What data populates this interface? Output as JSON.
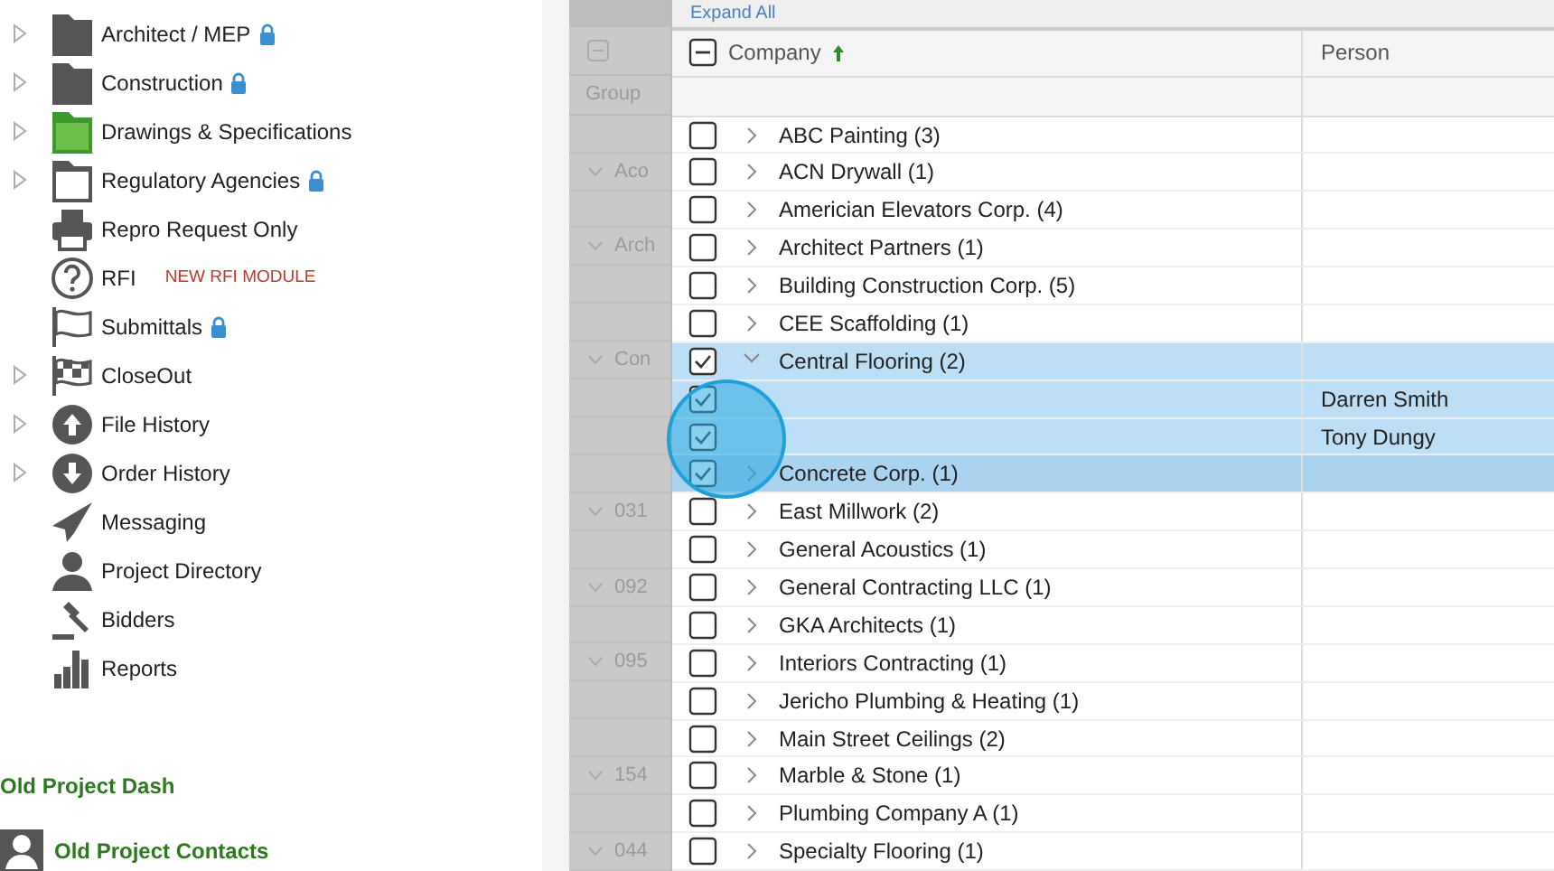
{
  "sidebar": {
    "items": [
      {
        "label": "Architect / MEP",
        "kind": "folder-dark",
        "expandable": true,
        "locked": true
      },
      {
        "label": "Construction",
        "kind": "folder-dark",
        "expandable": true,
        "locked": true
      },
      {
        "label": "Drawings & Specifications",
        "kind": "folder-green",
        "expandable": true,
        "locked": false
      },
      {
        "label": "Regulatory Agencies",
        "kind": "folder-outline",
        "expandable": true,
        "locked": true
      },
      {
        "label": "Repro Request Only",
        "kind": "printer",
        "expandable": false,
        "locked": false
      },
      {
        "label": "RFI",
        "kind": "question",
        "expandable": false,
        "locked": false,
        "badge": "NEW RFI MODULE"
      },
      {
        "label": "Submittals",
        "kind": "flag",
        "expandable": false,
        "locked": true
      },
      {
        "label": "CloseOut",
        "kind": "checkered",
        "expandable": true,
        "locked": false
      },
      {
        "label": "File History",
        "kind": "upload",
        "expandable": true,
        "locked": false
      },
      {
        "label": "Order History",
        "kind": "download",
        "expandable": true,
        "locked": false
      },
      {
        "label": "Messaging",
        "kind": "plane",
        "expandable": false,
        "locked": false
      },
      {
        "label": "Project Directory",
        "kind": "person",
        "expandable": false,
        "locked": false
      },
      {
        "label": "Bidders",
        "kind": "gavel",
        "expandable": false,
        "locked": false
      },
      {
        "label": "Reports",
        "kind": "chart",
        "expandable": false,
        "locked": false
      }
    ],
    "links": [
      {
        "label": "Old Project Dash",
        "kind": "text"
      },
      {
        "label": "Old Project Contacts",
        "kind": "contact"
      }
    ]
  },
  "backdrop_table": {
    "header": "Group",
    "rows": [
      {},
      {
        "label": "Aco"
      },
      {},
      {
        "label": "Arch"
      },
      {},
      {},
      {
        "label": "Con"
      },
      {},
      {},
      {},
      {
        "label": "031"
      },
      {},
      {
        "label": "092"
      },
      {},
      {
        "label": "095"
      },
      {},
      {},
      {
        "label": "154"
      },
      {},
      {
        "label": "044"
      }
    ]
  },
  "grid": {
    "toolbar": "Expand All",
    "header_indeterminate": true,
    "columns": [
      {
        "label": "Company",
        "sorted_ascending": true
      },
      {
        "label": "Person",
        "sorted_ascending": false
      }
    ],
    "rows": [
      {
        "kind": "group",
        "label": "ABC Painting (3)",
        "checked": false,
        "expanded": false,
        "selected": false
      },
      {
        "kind": "group",
        "label": "ACN Drywall (1)",
        "checked": false,
        "expanded": false,
        "selected": false
      },
      {
        "kind": "group",
        "label": "Americian Elevators Corp. (4)",
        "checked": false,
        "expanded": false,
        "selected": false
      },
      {
        "kind": "group",
        "label": "Architect Partners (1)",
        "checked": false,
        "expanded": false,
        "selected": false
      },
      {
        "kind": "group",
        "label": "Building Construction Corp. (5)",
        "checked": false,
        "expanded": false,
        "selected": false
      },
      {
        "kind": "group",
        "label": "CEE Scaffolding (1)",
        "checked": false,
        "expanded": false,
        "selected": false
      },
      {
        "kind": "group",
        "label": "Central Flooring (2)",
        "checked": true,
        "expanded": true,
        "selected": true
      },
      {
        "kind": "person",
        "person": "Darren Smith",
        "checked": true,
        "selected": true
      },
      {
        "kind": "person",
        "person": "Tony Dungy",
        "checked": true,
        "selected": true
      },
      {
        "kind": "group",
        "label": "Concrete Corp. (1)",
        "checked": true,
        "expanded": false,
        "selected": true,
        "hovered": true
      },
      {
        "kind": "group",
        "label": "East Millwork (2)",
        "checked": false,
        "expanded": false,
        "selected": false
      },
      {
        "kind": "group",
        "label": "General Acoustics (1)",
        "checked": false,
        "expanded": false,
        "selected": false
      },
      {
        "kind": "group",
        "label": "General Contracting LLC (1)",
        "checked": false,
        "expanded": false,
        "selected": false
      },
      {
        "kind": "group",
        "label": "GKA Architects (1)",
        "checked": false,
        "expanded": false,
        "selected": false
      },
      {
        "kind": "group",
        "label": "Interiors Contracting (1)",
        "checked": false,
        "expanded": false,
        "selected": false
      },
      {
        "kind": "group",
        "label": "Jericho Plumbing & Heating (1)",
        "checked": false,
        "expanded": false,
        "selected": false
      },
      {
        "kind": "group",
        "label": "Main Street Ceilings (2)",
        "checked": false,
        "expanded": false,
        "selected": false
      },
      {
        "kind": "group",
        "label": "Marble & Stone (1)",
        "checked": false,
        "expanded": false,
        "selected": false
      },
      {
        "kind": "group",
        "label": "Plumbing Company A (1)",
        "checked": false,
        "expanded": false,
        "selected": false
      },
      {
        "kind": "group",
        "label": "Specialty Flooring (1)",
        "checked": false,
        "expanded": false,
        "selected": false
      }
    ]
  }
}
